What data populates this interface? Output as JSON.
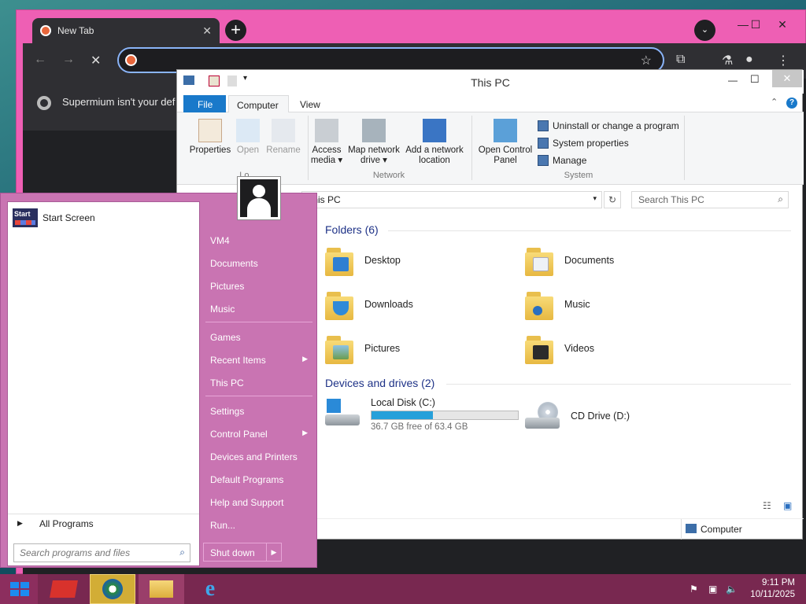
{
  "browser": {
    "tab_title": "New Tab",
    "tab_close": "✕",
    "new_tab": "+",
    "menu": "⌄",
    "infobar_text": "Supermium isn't your def",
    "win_min": "—",
    "win_max": "☐",
    "win_close": "✕"
  },
  "explorer": {
    "title": "This PC",
    "tabs": [
      "File",
      "Computer",
      "View"
    ],
    "ribbon": {
      "properties": "Properties",
      "open": "Open",
      "rename": "Rename",
      "location_group": "Lo...",
      "access_media": "Access media ▾",
      "map_drive": "Map network drive ▾",
      "add_location": "Add a network location",
      "network_group": "Network",
      "control_panel": "Open Control Panel",
      "uninstall": "Uninstall or change a program",
      "sys_props": "System properties",
      "manage": "Manage",
      "system_group": "System"
    },
    "address": "This PC",
    "search_placeholder": "Search This PC",
    "folders_header": "Folders (6)",
    "folders": [
      "Desktop",
      "Documents",
      "Downloads",
      "Music",
      "Pictures",
      "Videos"
    ],
    "drives_header": "Devices and drives (2)",
    "drive_c": {
      "name": "Local Disk (C:)",
      "free": "36.7 GB free of 63.4 GB",
      "used_fraction": 0.42
    },
    "drive_d": {
      "name": "CD Drive (D:)"
    },
    "status": "Computer"
  },
  "start_menu": {
    "pinned": "Start Screen",
    "pinned_logo": "Start",
    "all_programs": "All Programs",
    "search_placeholder": "Search programs and files",
    "right": [
      "VM4",
      "Documents",
      "Pictures",
      "Music",
      "Games",
      "Recent Items",
      "This PC",
      "Settings",
      "Control Panel",
      "Devices and Printers",
      "Default Programs",
      "Help and Support",
      "Run..."
    ],
    "shutdown": "Shut down"
  },
  "taskbar": {
    "time": "9:11 PM",
    "date": "10/11/2025"
  }
}
